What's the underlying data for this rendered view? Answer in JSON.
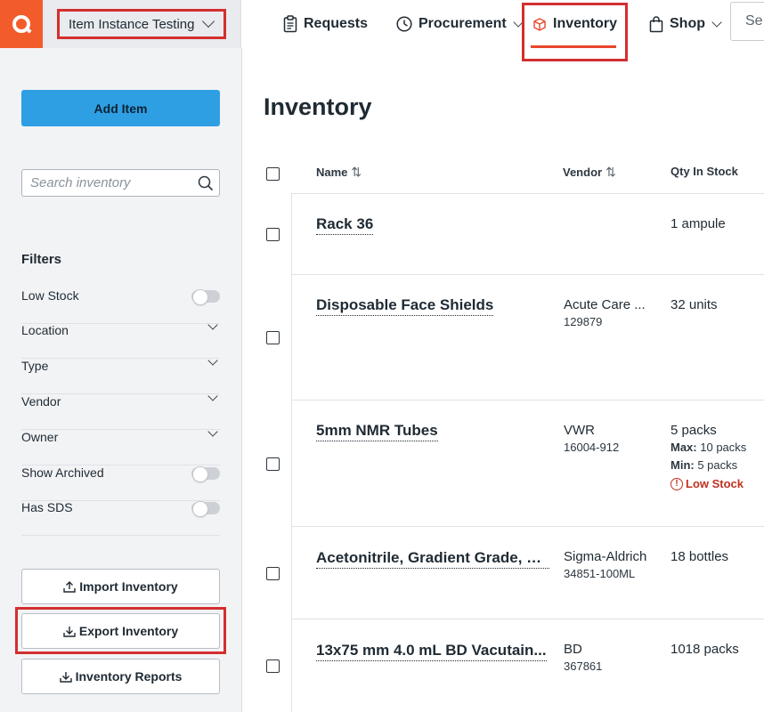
{
  "org": {
    "name": "Item Instance Testing"
  },
  "nav": {
    "requests": "Requests",
    "procurement": "Procurement",
    "inventory": "Inventory",
    "shop": "Shop",
    "search_placeholder": "Se"
  },
  "sidebar": {
    "add_item": "Add Item",
    "search_placeholder": "Search inventory",
    "filters_title": "Filters",
    "filters": [
      {
        "label": "Low Stock",
        "control": "toggle"
      },
      {
        "label": "Location",
        "control": "dropdown"
      },
      {
        "label": "Type",
        "control": "dropdown"
      },
      {
        "label": "Vendor",
        "control": "dropdown"
      },
      {
        "label": "Owner",
        "control": "dropdown"
      },
      {
        "label": "Show Archived",
        "control": "toggle"
      },
      {
        "label": "Has SDS",
        "control": "toggle"
      }
    ],
    "import": "Import Inventory",
    "export": "Export Inventory",
    "reports": "Inventory Reports"
  },
  "main": {
    "title": "Inventory",
    "columns": {
      "name": "Name",
      "vendor": "Vendor",
      "qty": "Qty In Stock"
    },
    "rows": [
      {
        "name": "Rack 36",
        "vendor": "",
        "catalog": "",
        "qty": "1 ampule"
      },
      {
        "name": "Disposable Face Shields",
        "vendor": "Acute Care ...",
        "catalog": "129879",
        "qty": "32 units"
      },
      {
        "name": "5mm NMR Tubes",
        "vendor": "VWR",
        "catalog": "16004-912",
        "qty": "5 packs",
        "max_label": "Max:",
        "max_value": "10 packs",
        "min_label": "Min:",
        "min_value": "5 packs",
        "status": "Low Stock"
      },
      {
        "name": "Acetonitrile, Gradient Grade, Li...",
        "vendor": "Sigma-Aldrich",
        "catalog": "34851-100ML",
        "qty": "18 bottles"
      },
      {
        "name": "13x75 mm 4.0 mL BD Vacutain...",
        "vendor": "BD",
        "catalog": "367861",
        "qty": "1018 packs"
      }
    ]
  },
  "colors": {
    "brand": "#f25c2a",
    "primary_button": "#2f9fe3",
    "annotation": "#d32f2f",
    "low_stock": "#c0311f"
  }
}
